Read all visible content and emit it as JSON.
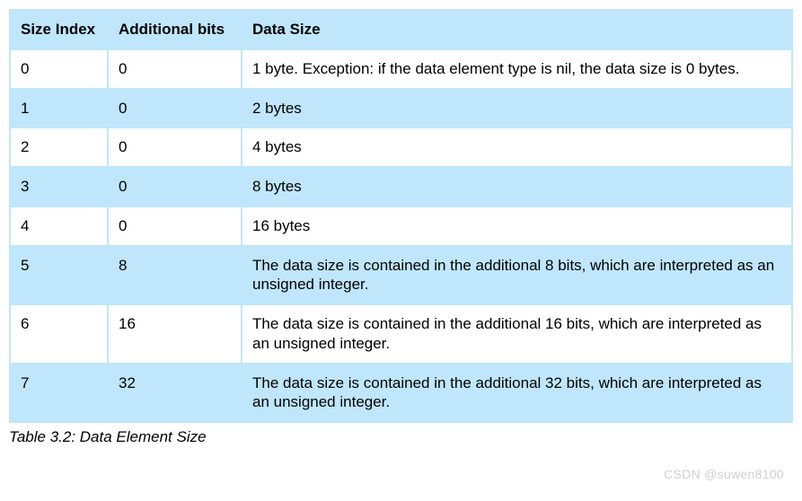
{
  "chart_data": {
    "type": "table",
    "title": "Table 3.2:  Data Element Size",
    "columns": [
      "Size Index",
      "Additional bits",
      "Data Size"
    ],
    "rows": [
      [
        "0",
        "0",
        "1 byte. Exception: if the data element type is nil, the data size is 0 bytes."
      ],
      [
        "1",
        "0",
        "2 bytes"
      ],
      [
        "2",
        "0",
        "4 bytes"
      ],
      [
        "3",
        "0",
        "8 bytes"
      ],
      [
        "4",
        "0",
        "16 bytes"
      ],
      [
        "5",
        "8",
        "The data size is contained in the additional 8 bits, which are interpreted as an unsigned integer."
      ],
      [
        "6",
        "16",
        "The data size is contained in the additional 16 bits, which are interpreted as an unsigned integer."
      ],
      [
        "7",
        "32",
        "The data size is contained in the additional 32 bits, which are interpreted as an unsigned integer."
      ]
    ]
  },
  "headers": {
    "c0": "Size Index",
    "c1": "Additional bits",
    "c2": "Data Size"
  },
  "rows": {
    "r0": {
      "c0": "0",
      "c1": "0",
      "c2": "1 byte. Exception: if the data element type is nil, the data size is 0 bytes."
    },
    "r1": {
      "c0": "1",
      "c1": "0",
      "c2": "2 bytes"
    },
    "r2": {
      "c0": "2",
      "c1": "0",
      "c2": "4 bytes"
    },
    "r3": {
      "c0": "3",
      "c1": "0",
      "c2": "8 bytes"
    },
    "r4": {
      "c0": "4",
      "c1": "0",
      "c2": "16 bytes"
    },
    "r5": {
      "c0": "5",
      "c1": "8",
      "c2": "The data size is contained in the additional 8 bits, which are interpreted as an unsigned integer."
    },
    "r6": {
      "c0": "6",
      "c1": "16",
      "c2": "The data size is contained in the additional 16 bits, which are interpreted as an unsigned integer."
    },
    "r7": {
      "c0": "7",
      "c1": "32",
      "c2": "The data size is contained in the additional 32 bits, which are interpreted as an unsigned integer."
    }
  },
  "caption": "Table 3.2:  Data Element Size",
  "watermark": "CSDN @suwen8100"
}
